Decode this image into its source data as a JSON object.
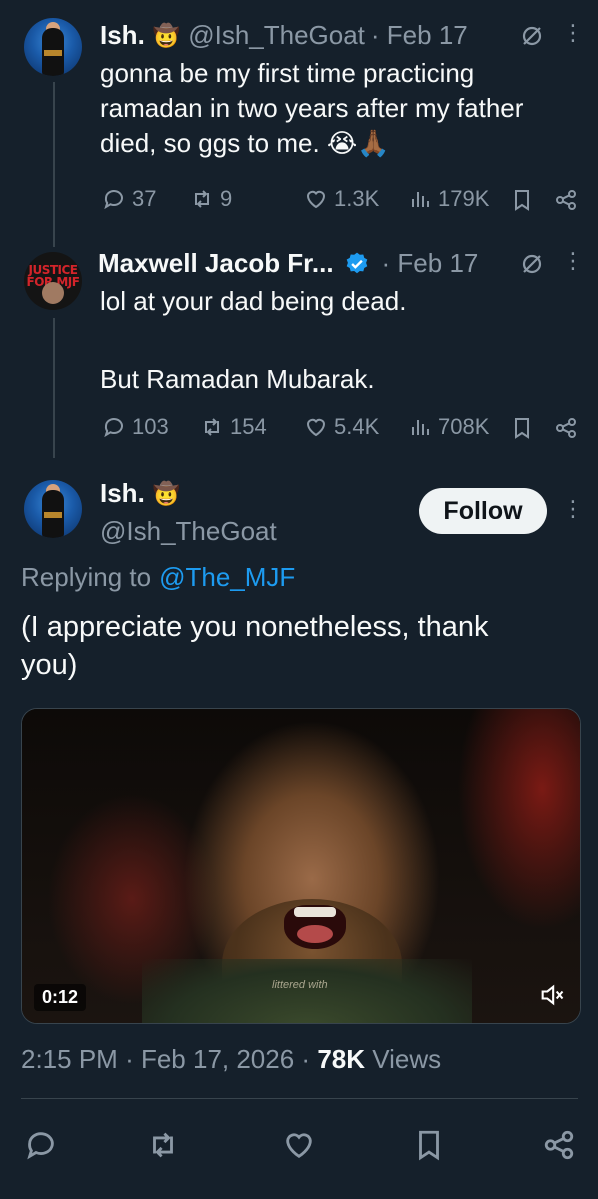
{
  "tweet1": {
    "name": "Ish.",
    "emoji": "🤠",
    "handle": "@Ish_TheGoat",
    "date": "· Feb 17",
    "lines": [
      "gonna be my first time practicing",
      "ramadan in two years after my father",
      "died, so ggs to me. 😭🙏🏾"
    ],
    "replies": "37",
    "reposts": "9",
    "likes": "1.3K",
    "views": "179K"
  },
  "tweet2": {
    "name": "Maxwell Jacob Fr...",
    "verified": true,
    "date": "· Feb 17",
    "avatar_text": "JUSTICE FOR MJF",
    "line1": "lol at your dad being dead.",
    "line2": "But Ramadan Mubarak.",
    "replies": "103",
    "reposts": "154",
    "likes": "5.4K",
    "views": "708K"
  },
  "main_tweet": {
    "name": "Ish.",
    "emoji": "🤠",
    "handle": "@Ish_TheGoat",
    "follow_label": "Follow",
    "replying_prefix": "Replying to",
    "replying_handle": "@The_MJF",
    "lines": [
      "(I appreciate you nonetheless, thank",
      "you)"
    ],
    "video_duration": "0:12",
    "video_caption": "littered with",
    "time": "2:15 PM",
    "date": "Feb 17, 2026",
    "views_count": "78K",
    "views_label": "Views"
  },
  "colors": {
    "background": "#15202b",
    "text": "#f7f9f9",
    "muted": "#8b98a5",
    "link": "#1d9bf0",
    "verified": "#1d9bf0",
    "follow_bg": "#eff3f4"
  }
}
